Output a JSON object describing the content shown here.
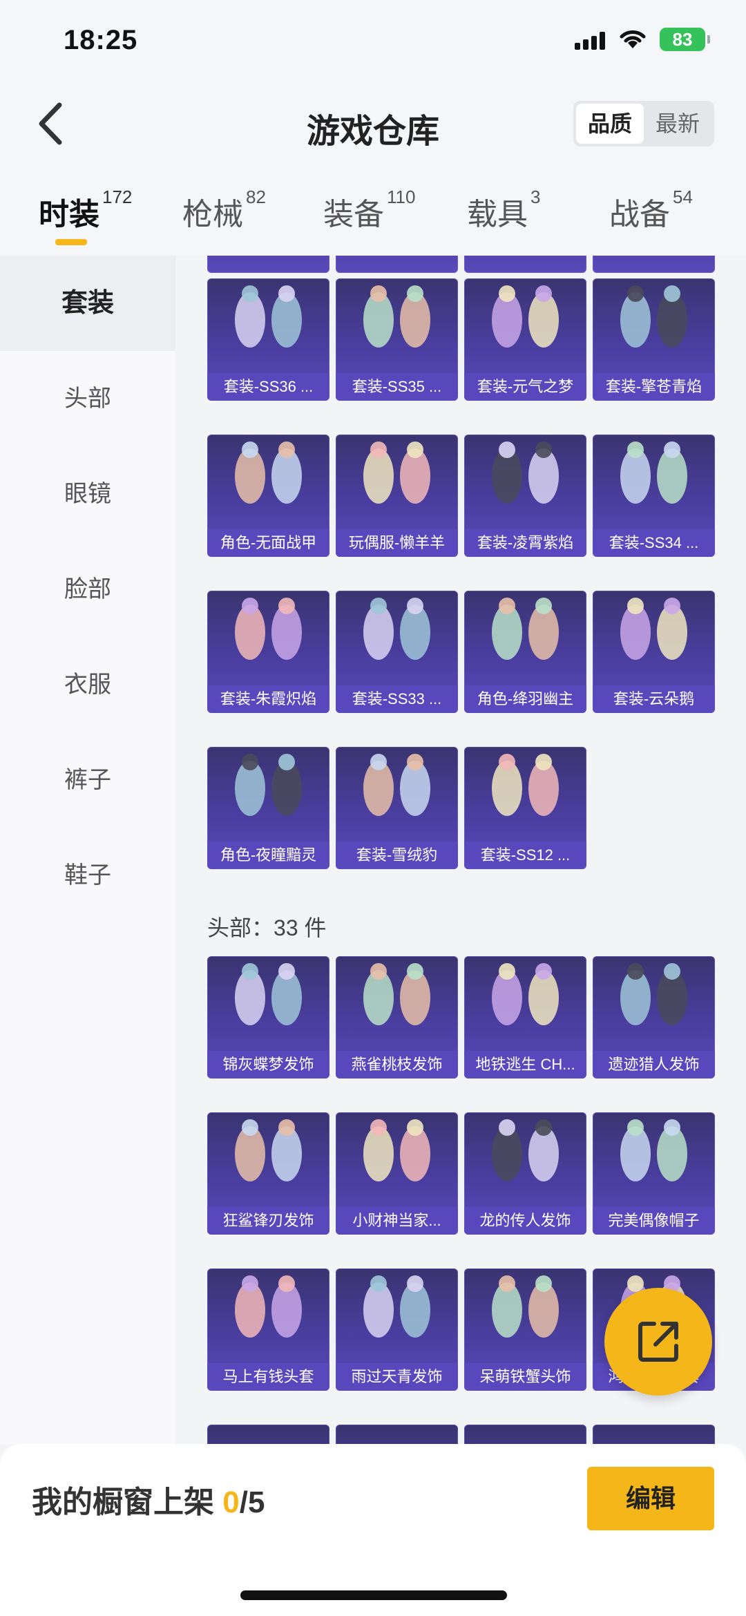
{
  "status": {
    "time": "18:25",
    "battery": "83"
  },
  "header": {
    "title": "游戏仓库",
    "sort_quality": "品质",
    "sort_newest": "最新"
  },
  "tabs": [
    {
      "label": "时装",
      "count": "172"
    },
    {
      "label": "枪械",
      "count": "82"
    },
    {
      "label": "装备",
      "count": "110"
    },
    {
      "label": "载具",
      "count": "3"
    },
    {
      "label": "战备",
      "count": "54"
    }
  ],
  "sidebar": [
    "套装",
    "头部",
    "眼镜",
    "脸部",
    "衣服",
    "裤子",
    "鞋子"
  ],
  "suits": [
    "套装-SS36 ...",
    "套装-SS35 ...",
    "套装-元气之梦",
    "套装-擎苍青焰",
    "角色-无面战甲",
    "玩偶服-懒羊羊",
    "套装-凌霄紫焰",
    "套装-SS34 ...",
    "套装-朱霞炽焰",
    "套装-SS33 ...",
    "角色-绛羽幽主",
    "套装-云朵鹅",
    "角色-夜瞳黯灵",
    "套装-雪绒豹",
    "套装-SS12 ..."
  ],
  "head_section": {
    "label": "头部：",
    "count": "33",
    "unit": "件"
  },
  "heads": [
    "锦灰蝶梦发饰",
    "燕雀桃枝发饰",
    "地铁逃生 CH...",
    "遗迹猎人发饰",
    "狂鲨锋刃发饰",
    "小财神当家...",
    "龙的传人发饰",
    "完美偶像帽子",
    "马上有钱头套",
    "雨过天青发饰",
    "呆萌铁蟹头饰",
    "鸿运当头头套"
  ],
  "bottom": {
    "showcase_label": "我的橱窗上架 ",
    "current": "0",
    "total": "/5",
    "edit": "编辑"
  }
}
